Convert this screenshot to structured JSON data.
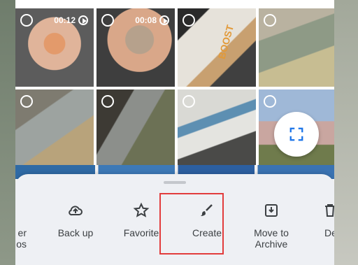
{
  "photos": [
    {
      "duration": "00:12"
    },
    {
      "duration": "00:08"
    },
    {
      "duration": ""
    },
    {
      "duration": ""
    },
    {
      "duration": ""
    },
    {
      "duration": ""
    },
    {
      "duration": ""
    },
    {
      "duration": ""
    }
  ],
  "photo_overlay_text": {
    "boost": "BOOST"
  },
  "actions": {
    "share_partial_1": "er",
    "share_partial_2": "os",
    "backup": "Back up",
    "favorite": "Favorite",
    "create": "Create",
    "archive_1": "Move to",
    "archive_2": "Archive",
    "delete_partial": "De"
  },
  "colors": {
    "highlight": "#e23c3c",
    "accent": "#1a73e8"
  }
}
